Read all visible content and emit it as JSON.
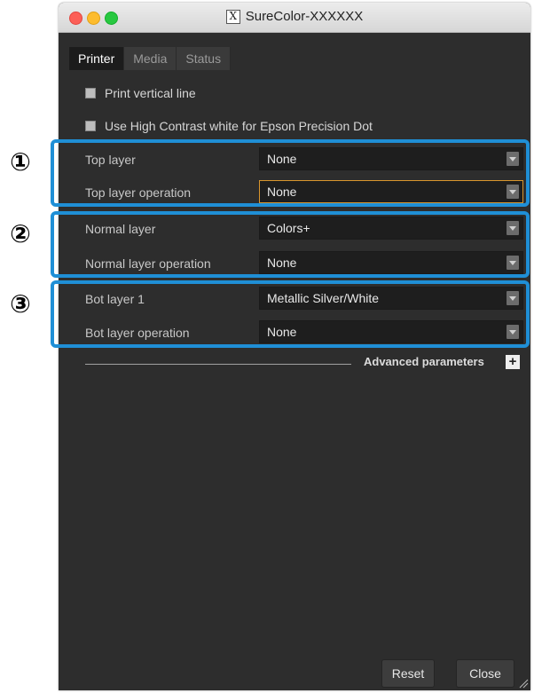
{
  "window": {
    "title": "SureColor-XXXXXX",
    "title_icon_glyph": "X"
  },
  "tabs": [
    {
      "label": "Printer",
      "active": true
    },
    {
      "label": "Media",
      "active": false
    },
    {
      "label": "Status",
      "active": false
    }
  ],
  "checkboxes": [
    {
      "label": "Print vertical line",
      "checked": false
    },
    {
      "label": "Use High Contrast white for Epson Precision Dot",
      "checked": false
    }
  ],
  "groups": [
    {
      "callout": "①",
      "rows": [
        {
          "label": "Top layer",
          "colon": ":",
          "value": "None",
          "focused": false
        },
        {
          "label": "Top layer operation",
          "colon": ":",
          "value": "None",
          "focused": true
        }
      ]
    },
    {
      "callout": "②",
      "rows": [
        {
          "label": "Normal layer",
          "colon": ":",
          "value": "Colors+",
          "focused": false
        },
        {
          "label": "Normal layer operation",
          "colon": ":",
          "value": "None",
          "focused": false
        }
      ]
    },
    {
      "callout": "③",
      "rows": [
        {
          "label": "Bot layer 1",
          "colon": ":",
          "value": "Metallic Silver/White",
          "focused": false
        },
        {
          "label": "Bot layer operation",
          "colon": ":",
          "value": "None",
          "focused": false
        }
      ]
    }
  ],
  "advanced": {
    "label": "Advanced parameters",
    "toggle": "+"
  },
  "buttons": {
    "reset": "Reset",
    "close": "Close"
  },
  "colors": {
    "annotation_border": "#1f8fd6",
    "focus_border": "#d9962d",
    "background": "#2d2d2d"
  }
}
